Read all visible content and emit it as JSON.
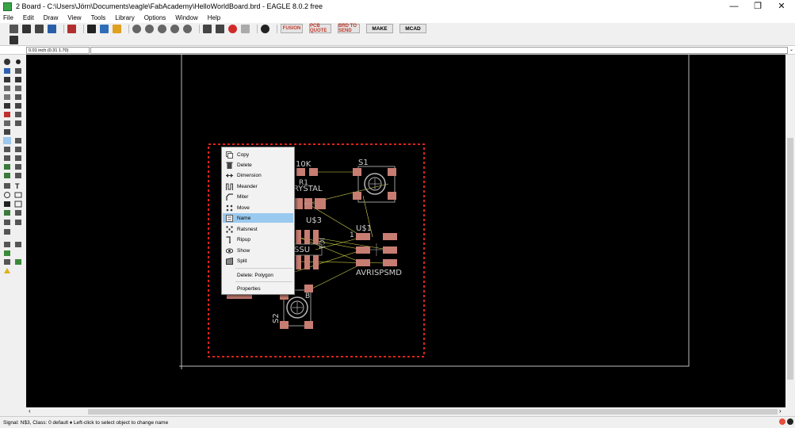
{
  "window": {
    "title": "2 Board - C:\\Users\\Jörn\\Documents\\eagle\\FabAcademy\\HelloWorldBoard.brd - EAGLE 8.0.2 free",
    "minimize": "—",
    "maximize": "❐",
    "close": "✕"
  },
  "menu": [
    "File",
    "Edit",
    "Draw",
    "View",
    "Tools",
    "Library",
    "Options",
    "Window",
    "Help"
  ],
  "toolbar": {
    "make_label": "MAKE",
    "mcad_label": "MCAD",
    "fusion_label": "FUSION",
    "pcb_label": "PCB QUOTE",
    "cam_label": "BRD TO SEND"
  },
  "coordinate": "0.01 inch (0.31 1.70)",
  "context_menu": {
    "items": [
      {
        "label": "Copy",
        "icon": "copy-icon"
      },
      {
        "label": "Delete",
        "icon": "trash-icon"
      },
      {
        "label": "Dimension",
        "icon": "dimension-icon"
      },
      {
        "label": "Meander",
        "icon": "meander-icon"
      },
      {
        "label": "Miter",
        "icon": "miter-icon"
      },
      {
        "label": "Move",
        "icon": "move-icon"
      },
      {
        "label": "Name",
        "icon": "name-icon",
        "active": true
      },
      {
        "label": "Ratsnest",
        "icon": "ratsnest-icon"
      },
      {
        "label": "Ripup",
        "icon": "ripup-icon"
      },
      {
        "label": "Show",
        "icon": "eye-icon"
      },
      {
        "label": "Split",
        "icon": "split-icon"
      }
    ],
    "polygon_item": "Delete: Polygon",
    "properties_item": "Properties"
  },
  "board": {
    "labels": {
      "r_value": "10K",
      "r_name": "R1",
      "crystal": "RYSTAL",
      "u3": "U$3",
      "s1": "S1",
      "u1": "U$1",
      "pin1": "1",
      "avr": "AVRISPSMD",
      "ssu": "SSU",
      "ic1": "IC1",
      "s2": "S2",
      "b": "B"
    }
  },
  "status": "Signal: N$3, Class: 0 default  ♦ Left-click to select object to change name",
  "colors": {
    "canvas": "#000000",
    "outline_red": "#e0231b",
    "pad": "#c87d72",
    "highlight": "#99c9ef"
  }
}
